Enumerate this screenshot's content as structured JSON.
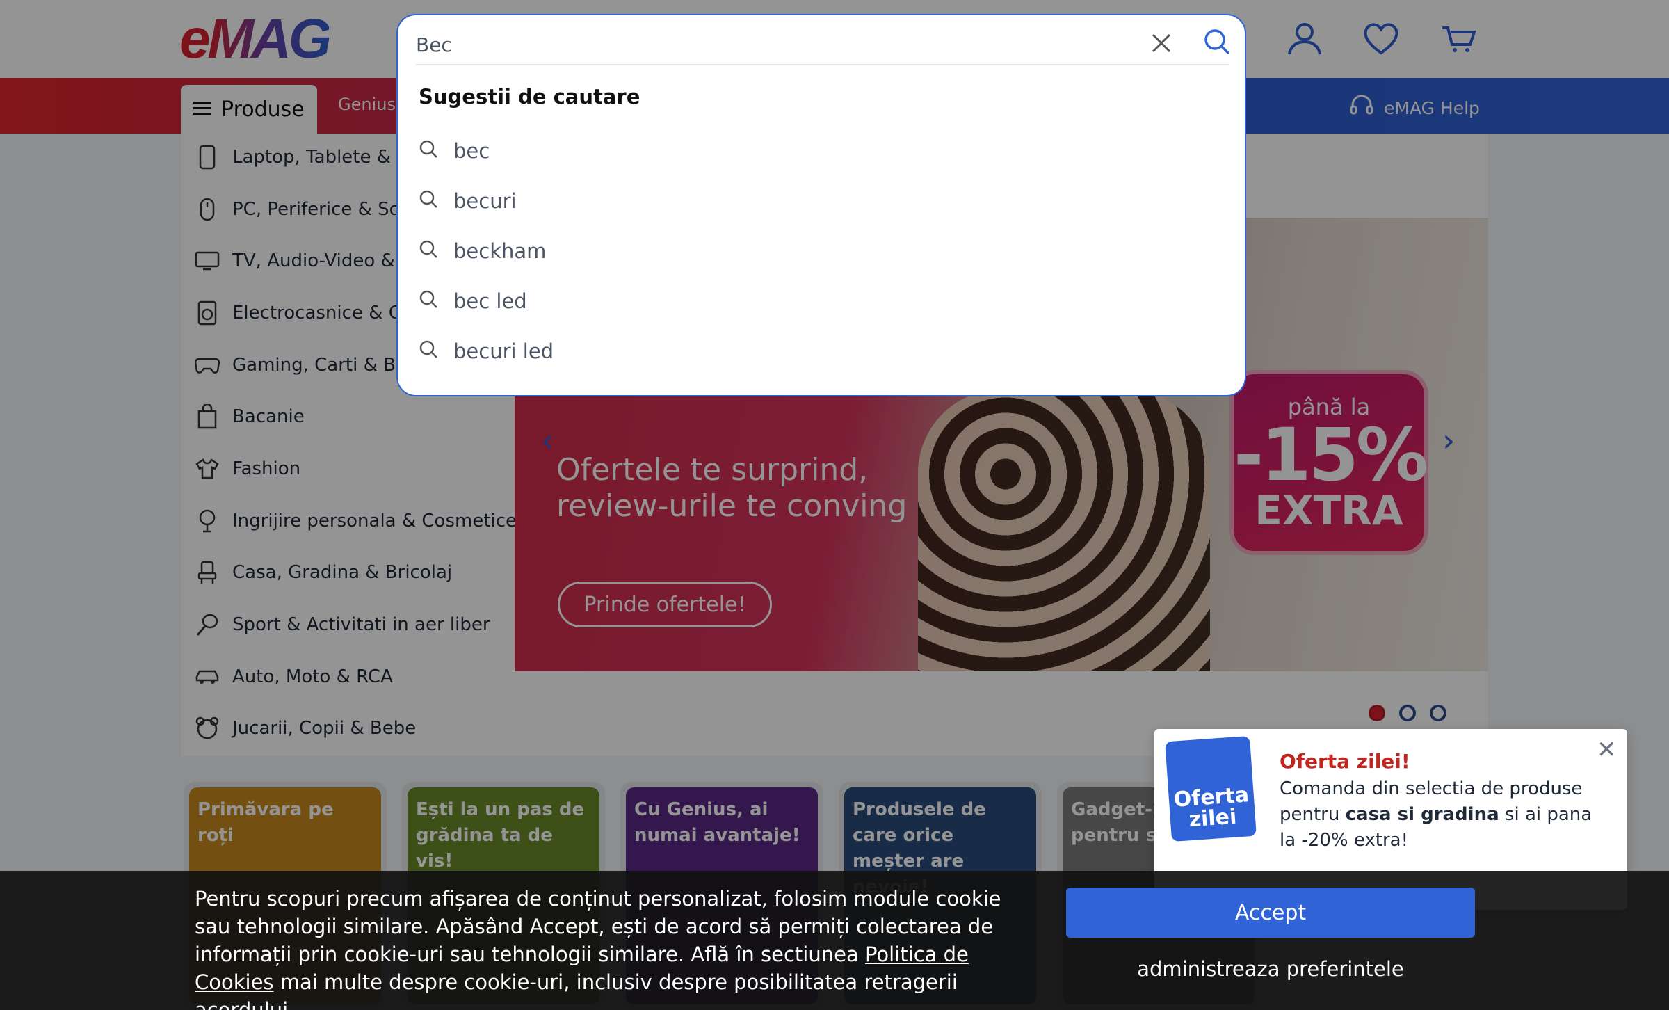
{
  "header": {
    "logo_text_e": "e",
    "logo_text_mag": "MAG",
    "produse_label": "Produse",
    "genius_label": "Genius",
    "help_label": "eMAG Help",
    "icons": [
      "user-icon",
      "heart-icon",
      "cart-icon"
    ]
  },
  "sidebar": {
    "items": [
      {
        "label": "Laptop, Tablete & Te",
        "icon": "phone-icon"
      },
      {
        "label": "PC, Periferice & Sof",
        "icon": "mouse-icon"
      },
      {
        "label": "TV, Audio-Video & F",
        "icon": "tv-icon"
      },
      {
        "label": "Electrocasnice & Cli",
        "icon": "washer-icon"
      },
      {
        "label": "Gaming, Carti & Bir",
        "icon": "gamepad-icon"
      },
      {
        "label": "Bacanie",
        "icon": "bag-icon"
      },
      {
        "label": "Fashion",
        "icon": "shirt-icon"
      },
      {
        "label": "Ingrijire personala & Cosmetice",
        "icon": "mirror-icon"
      },
      {
        "label": "Casa, Gradina & Bricolaj",
        "icon": "chair-icon"
      },
      {
        "label": "Sport & Activitati in aer liber",
        "icon": "racket-icon"
      },
      {
        "label": "Auto, Moto & RCA",
        "icon": "car-icon"
      },
      {
        "label": "Jucarii, Copii & Bebe",
        "icon": "teddy-icon"
      }
    ]
  },
  "banner": {
    "headline_1": "Ofertele te surprind,",
    "headline_2": "review-urile te conving",
    "cta": "Prinde ofertele!",
    "badge_small": "până la",
    "badge_big": "-15%",
    "badge_extra": "EXTRA"
  },
  "cards": [
    {
      "title": "Primăvara pe roți",
      "color": "#c9891f"
    },
    {
      "title": "Ești la un pas de grădina ta de vis!",
      "color": "#6a8a2a"
    },
    {
      "title": "Cu Genius, ai numai avantaje!",
      "color": "#5b2a86"
    },
    {
      "title": "Produsele de care orice meșter are nevoie!",
      "color": "#2a4c7a"
    },
    {
      "title": "Gadget-uri pentru sp",
      "color": "#7a7a7a"
    }
  ],
  "search": {
    "value": "Bec",
    "suggestions_title": "Sugestii de cautare",
    "suggestions": [
      "bec",
      "becuri",
      "beckham",
      "bec led",
      "becuri led"
    ]
  },
  "offer": {
    "badge_1": "Oferta",
    "badge_2": "zilei",
    "title": "Oferta zilei!",
    "text_1": "Comanda din selectia de produse pentru ",
    "text_bold": "casa si gradina",
    "text_2": " si ai pana la -20% extra!"
  },
  "cookie": {
    "text_1": "Pentru scopuri precum afișarea de conținut personalizat, folosim module cookie sau tehnologii similare. Apăsând Accept, ești de acord să permiți colectarea de informații prin cookie-uri sau tehnologii similare. Află în sectiunea ",
    "link": "Politica de Cookies",
    "text_2": " mai multe despre cookie-uri, inclusiv despre posibilitatea retragerii acordului.",
    "accept": "Accept",
    "prefs": "administreaza preferintele"
  },
  "colors": {
    "brand_red": "#d6222d",
    "brand_blue": "#2f63d6"
  }
}
